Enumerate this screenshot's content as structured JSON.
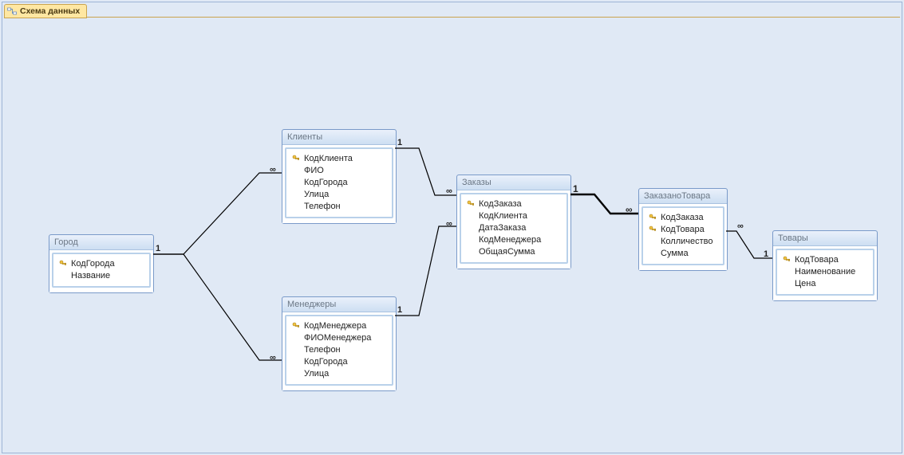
{
  "tab": {
    "label": "Схема данных"
  },
  "tables": {
    "gorod": {
      "title": "Город",
      "fields": [
        "КодГорода",
        "Название"
      ],
      "pk": [
        0
      ]
    },
    "klienty": {
      "title": "Клиенты",
      "fields": [
        "КодКлиента",
        "ФИО",
        "КодГорода",
        "Улица",
        "Телефон"
      ],
      "pk": [
        0
      ]
    },
    "menedzhery": {
      "title": "Менеджеры",
      "fields": [
        "КодМенеджера",
        "ФИОМенеджера",
        "Телефон",
        "КодГорода",
        "Улица"
      ],
      "pk": [
        0
      ]
    },
    "zakazy": {
      "title": "Заказы",
      "fields": [
        "КодЗаказа",
        "КодКлиента",
        "ДатаЗаказа",
        "КодМенеджера",
        "ОбщаяСумма"
      ],
      "pk": [
        0
      ]
    },
    "zakazanotovara": {
      "title": "ЗаказаноТовара",
      "fields": [
        "КодЗаказа",
        "КодТовара",
        "Колличество",
        "Сумма"
      ],
      "pk": [
        0,
        1
      ]
    },
    "tovary": {
      "title": "Товары",
      "fields": [
        "КодТовара",
        "Наименование",
        "Цена"
      ],
      "pk": [
        0
      ]
    }
  },
  "labels": {
    "one": "1",
    "many": "∞"
  }
}
